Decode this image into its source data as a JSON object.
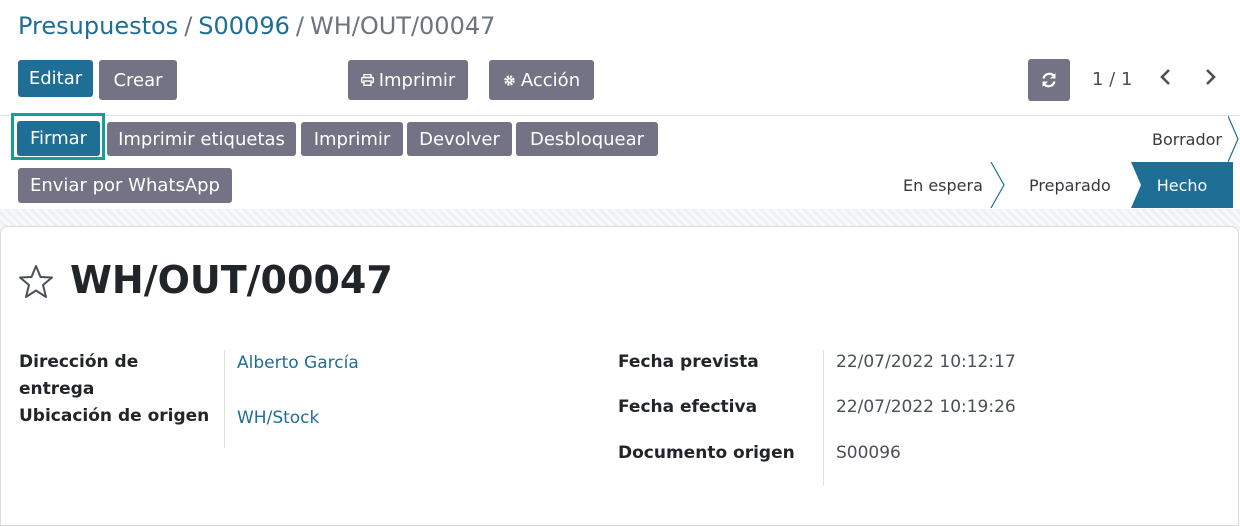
{
  "breadcrumb": {
    "items": [
      "Presupuestos",
      "S00096"
    ],
    "separator": "/",
    "current": "WH/OUT/00047"
  },
  "toolbar": {
    "edit": "Editar",
    "create": "Crear",
    "print": "Imprimir",
    "action": "Acción"
  },
  "pager": {
    "value": "1 / 1"
  },
  "header_buttons": {
    "sign": "Firmar",
    "print_labels": "Imprimir etiquetas",
    "print": "Imprimir",
    "return": "Devolver",
    "unlock": "Desbloquear",
    "whatsapp": "Enviar por WhatsApp"
  },
  "status": {
    "draft": "Borrador",
    "waiting": "En espera",
    "ready": "Preparado",
    "done": "Hecho"
  },
  "record": {
    "title": "WH/OUT/00047",
    "fields_left": [
      {
        "label_line1": "Dirección de",
        "label_line2": "entrega",
        "value": "Alberto García"
      },
      {
        "label": "Ubicación de origen",
        "value": "WH/Stock"
      }
    ],
    "fields_right": [
      {
        "label": "Fecha prevista",
        "value": "22/07/2022 10:12:17"
      },
      {
        "label": "Fecha efectiva",
        "value": "22/07/2022 10:19:26"
      },
      {
        "label": "Documento origen",
        "value": "S00096"
      }
    ]
  },
  "colors": {
    "primary": "#1f6e96",
    "secondary": "#737385",
    "highlight": "#14a098"
  }
}
